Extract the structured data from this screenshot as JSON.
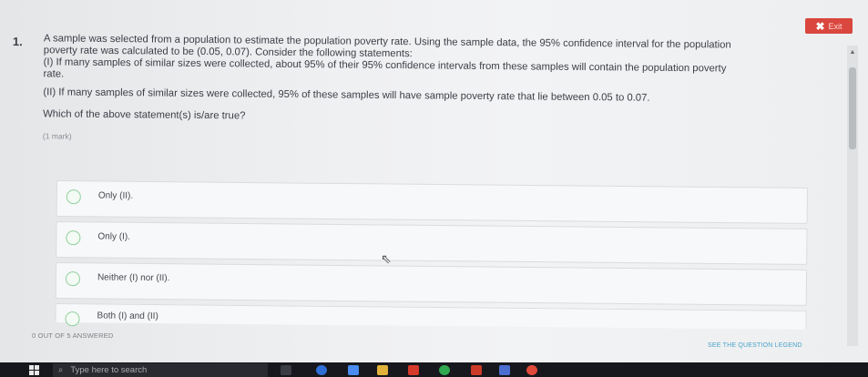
{
  "exit": {
    "icon": "close-icon",
    "label": "Exit"
  },
  "question": {
    "number": "1.",
    "line1": "A sample was selected from a population to estimate the population poverty rate. Using the sample data, the 95% confidence interval for the population",
    "line2": "poverty rate was calculated to be (0.05, 0.07). Consider the following statements:",
    "stmt1a": "(I)   If many samples of similar sizes were collected, about 95% of their 95% confidence intervals from these samples will contain the population poverty",
    "stmt1b": "rate.",
    "stmt2": "(II)   If many samples of similar sizes were collected, 95% of these samples will have sample poverty rate that lie between 0.05 to 0.07.",
    "ask": "Which of the above statement(s) is/are true?",
    "mark": "(1 mark)"
  },
  "options": [
    {
      "label": "Only (II)."
    },
    {
      "label": "Only (I)."
    },
    {
      "label": "Neither (I) nor (II)."
    },
    {
      "label": "Both (I) and (II)"
    }
  ],
  "footer": {
    "answered": "0 OUT OF 5 ANSWERED",
    "legend": "SEE THE QUESTION LEGEND"
  },
  "taskbar": {
    "search_placeholder": "Type here to search",
    "search_icon": "search-icon",
    "start_icon": "windows-icon"
  },
  "colors": {
    "exit": "#d9473e",
    "radio": "#8fcf9a",
    "legend": "#4aa3c9"
  }
}
